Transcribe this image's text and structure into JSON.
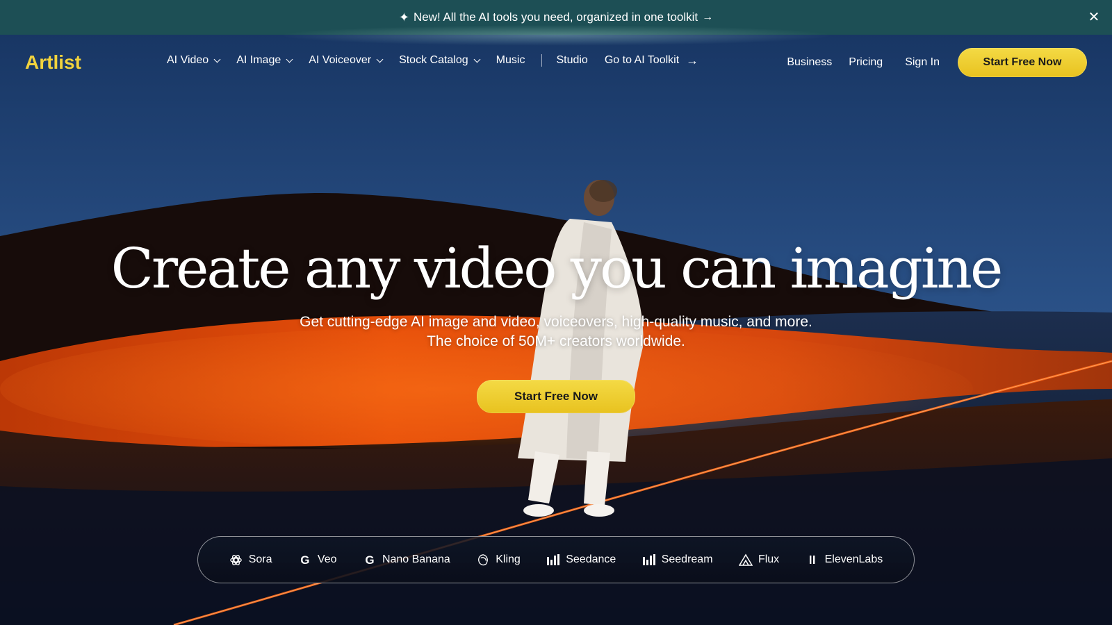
{
  "banner": {
    "text": "New! All the AI tools you need, organized in one toolkit",
    "icon": "sparkle-icon",
    "close_icon": "close-icon"
  },
  "nav": {
    "logo": "Artlist",
    "menu": [
      {
        "label": "AI Video",
        "dropdown": true
      },
      {
        "label": "AI Image",
        "dropdown": true
      },
      {
        "label": "AI Voiceover",
        "dropdown": true
      },
      {
        "label": "Stock Catalog",
        "dropdown": true
      },
      {
        "label": "Music",
        "dropdown": false
      },
      {
        "label": "Studio",
        "dropdown": false
      },
      {
        "label": "Go to AI Toolkit",
        "dropdown": false
      }
    ],
    "business": "Business",
    "pricing": "Pricing",
    "sign_in": "Sign In",
    "cta": "Start Free Now"
  },
  "hero": {
    "title": "Create any video you can imagine",
    "subtitle_line1": "Get cutting-edge AI image and video, voiceovers, high-quality music, and more.",
    "subtitle_line2": "The choice of 50M+ creators worldwide.",
    "cta": "Start Free Now"
  },
  "models": [
    {
      "label": "Sora",
      "icon": "openai-icon"
    },
    {
      "label": "Veo",
      "icon": "google-icon"
    },
    {
      "label": "Nano Banana",
      "icon": "google-icon"
    },
    {
      "label": "Kling",
      "icon": "kling-icon"
    },
    {
      "label": "Seedance",
      "icon": "bar-chart-icon"
    },
    {
      "label": "Seedream",
      "icon": "bar-chart-icon"
    },
    {
      "label": "Flux",
      "icon": "triangle-icon"
    },
    {
      "label": "ElevenLabs",
      "icon": "pause-icon"
    }
  ],
  "colors": {
    "brand_yellow": "#f2d33d",
    "banner_bg": "#1d4f55"
  }
}
